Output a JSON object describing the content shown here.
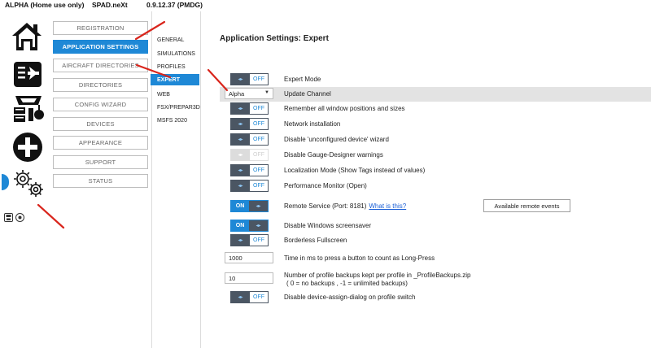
{
  "titlebar": {
    "app_name": "ALPHA (Home use only)",
    "product": "SPAD.neXt",
    "version": "0.9.12.37 (PMDG)"
  },
  "icon_bar": {
    "icons": [
      "home-icon",
      "aircraft-icon",
      "devices-icon",
      "add-icon",
      "gears-icon"
    ],
    "mini_icons": [
      "save-icon",
      "profile-icon"
    ]
  },
  "nav": {
    "items": [
      {
        "label": "REGISTRATION"
      },
      {
        "label": "APPLICATION SETTINGS"
      },
      {
        "label": "AIRCRAFT DIRECTORIES"
      },
      {
        "label": "DIRECTORIES"
      },
      {
        "label": "CONFIG WIZARD"
      },
      {
        "label": "DEVICES"
      },
      {
        "label": "APPEARANCE"
      },
      {
        "label": "SUPPORT"
      },
      {
        "label": "STATUS"
      }
    ],
    "active": "APPLICATION SETTINGS"
  },
  "sub_nav": {
    "items": [
      {
        "label": "GENERAL"
      },
      {
        "label": "SIMULATIONS"
      },
      {
        "label": "PROFILES"
      },
      {
        "label": "EXPERT"
      },
      {
        "label": "WEB"
      },
      {
        "label": "FSX/PREPAR3D"
      },
      {
        "label": "MSFS 2020"
      }
    ],
    "active": "EXPERT"
  },
  "content": {
    "title": "Application Settings: Expert",
    "toggle_knob_glyph": "◂▸",
    "settings": {
      "expert_mode": {
        "label": "Expert Mode",
        "state": "OFF"
      },
      "update_channel": {
        "label": "Update Channel",
        "value": "Alpha"
      },
      "remember_window": {
        "label": "Remember all window positions and sizes",
        "state": "OFF"
      },
      "network_installation": {
        "label": "Network installation",
        "state": "OFF"
      },
      "disable_unconfigured_wizard": {
        "label": "Disable 'unconfigured device' wizard",
        "state": "OFF"
      },
      "disable_gauge_designer_warnings": {
        "label": "Disable Gauge-Designer warnings",
        "state": "OFF"
      },
      "localization_mode": {
        "label": "Localization Mode (Show Tags instead of values)",
        "state": "OFF"
      },
      "performance_monitor": {
        "label": "Performance Monitor (Open)",
        "state": "OFF"
      },
      "remote_service": {
        "label": "Remote Service (Port: 8181)",
        "help": "What is this?",
        "state": "ON",
        "button": "Available remote events"
      },
      "disable_screensaver": {
        "label": "Disable Windows screensaver",
        "state": "ON"
      },
      "borderless_fullscreen": {
        "label": "Borderless Fullscreen",
        "state": "OFF"
      },
      "long_press_time": {
        "label": "Time in ms to press a button to count as Long-Press",
        "value": "1000"
      },
      "profile_backups": {
        "label": "Number of profile backups kept per profile in _ProfileBackups.zip",
        "label_line2": "( 0 = no backups , -1 = unlimited backups)",
        "value": "10"
      },
      "disable_device_assign_dialog": {
        "label": "Disable device-assign-dialog on profile switch",
        "state": "OFF"
      }
    }
  },
  "colors": {
    "accent": "#1e88d6",
    "toggle_dark": "#4b5663",
    "highlight_row": "#e3e3e3",
    "annotation_arrow": "#d9251c"
  }
}
